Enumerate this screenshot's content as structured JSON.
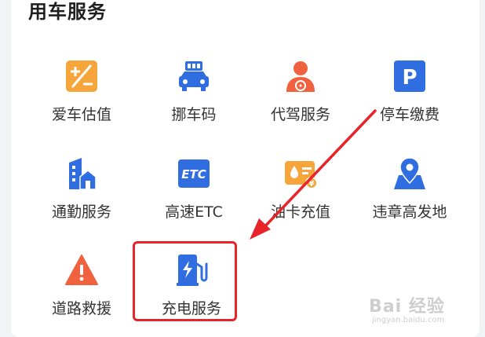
{
  "section": {
    "title": "用车服务"
  },
  "services": [
    {
      "label": "爱车估值"
    },
    {
      "label": "挪车码"
    },
    {
      "label": "代驾服务"
    },
    {
      "label": "停车缴费",
      "icon_text": "P"
    },
    {
      "label": "通勤服务"
    },
    {
      "label": "高速ETC",
      "icon_text": "ETC"
    },
    {
      "label": "油卡充值"
    },
    {
      "label": "违章高发地"
    },
    {
      "label": "道路救援"
    },
    {
      "label": "充电服务"
    }
  ],
  "watermark": {
    "main": "Bai 经验",
    "sub": "jingyan.baidu.com"
  },
  "colors": {
    "orange": "#f5a53a",
    "blue": "#2f6de1",
    "red_icon": "#f0623f",
    "annotation_red": "#e8232a"
  }
}
